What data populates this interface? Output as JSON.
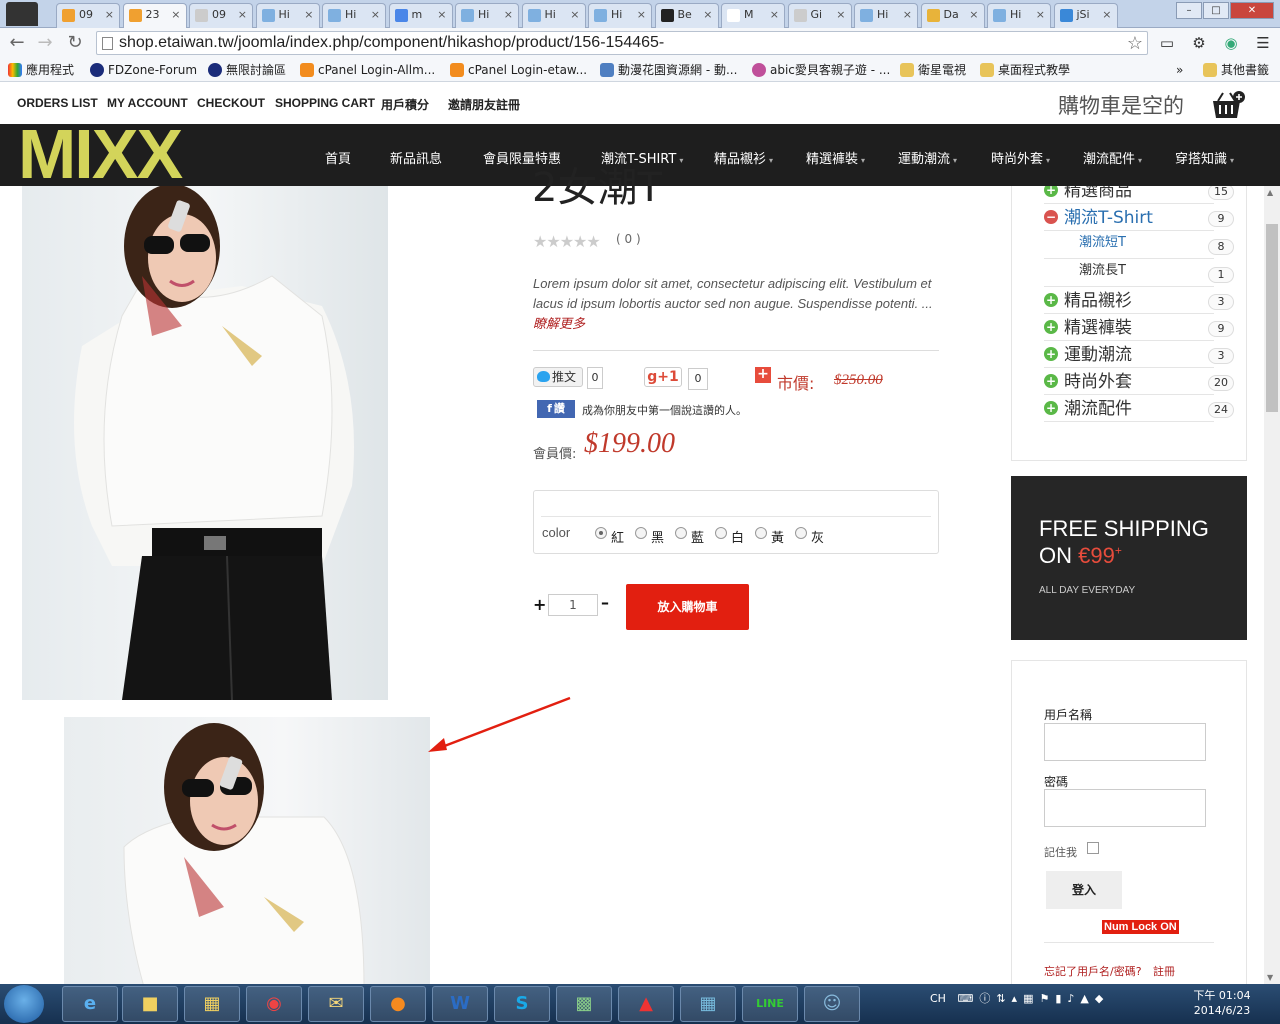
{
  "browser": {
    "tabs": [
      "09",
      "23",
      "09",
      "Hi",
      "Hi",
      "m",
      "Hi",
      "Hi",
      "Hi",
      "Be",
      "M",
      "Gi",
      "Hi",
      "Da",
      "Hi",
      "jSi"
    ],
    "url": "shop.etaiwan.tw/joomla/index.php/component/hikashop/product/156-154465-",
    "bookmarks": [
      "應用程式",
      "FDZone-Forum",
      "無限討論區",
      "cPanel Login-Allm...",
      "cPanel Login-etaw...",
      "動漫花園資源網 - 動...",
      "abic愛貝客親子遊 - ...",
      "衛星電視",
      "桌面程式教學"
    ],
    "other_bookmarks": "其他書籤",
    "bookmarks_more": "»"
  },
  "site": {
    "top_links": [
      "ORDERS LIST",
      "MY ACCOUNT",
      "CHECKOUT",
      "SHOPPING CART",
      "用戶積分",
      "邀請朋友註冊"
    ],
    "cart_status": "購物車是空的",
    "logo": "MIXX",
    "main_menu": [
      {
        "label": "首頁",
        "dropdown": false
      },
      {
        "label": "新品訊息",
        "dropdown": false
      },
      {
        "label": "會員限量特惠",
        "dropdown": false
      },
      {
        "label": "潮流T-SHIRT",
        "dropdown": true
      },
      {
        "label": "精品襯衫",
        "dropdown": true
      },
      {
        "label": "精選褲裝",
        "dropdown": true
      },
      {
        "label": "運動潮流",
        "dropdown": true
      },
      {
        "label": "時尚外套",
        "dropdown": true
      },
      {
        "label": "潮流配件",
        "dropdown": true
      },
      {
        "label": "穿搭知識",
        "dropdown": true
      }
    ],
    "caret": "▾"
  },
  "product": {
    "title_partial": "2女潮T",
    "rating_stars": "★★★★★",
    "rating_count": "( 0 )",
    "description": "Lorem ipsum dolor sit amet, consectetur adipiscing elit. Vestibulum et lacus id ipsum lobortis auctor sed non augue. Suspendisse potenti. ...",
    "read_more": "瞭解更多",
    "tweet_label": "推文",
    "tweet_count": "0",
    "gplus_label": "g+1",
    "gplus_count": "0",
    "market_price_label": "市價:",
    "market_price": "$250.00",
    "fb_like_label": "讚",
    "fb_like_text": "成為你朋友中第一個說這讚的人。",
    "member_price_label": "會員價:",
    "member_price": "$199.00",
    "option_label": "color",
    "color_options": [
      "紅",
      "黑",
      "藍",
      "白",
      "黃",
      "灰"
    ],
    "selected_color": "紅",
    "quantity": "1",
    "add_to_cart": "放入購物車"
  },
  "sidebar": {
    "categories": [
      {
        "label": "精選商品",
        "count": "15",
        "level": 0,
        "icon": "plus"
      },
      {
        "label": "潮流T-Shirt",
        "count": "9",
        "level": 0,
        "icon": "minus"
      },
      {
        "label": "潮流短T",
        "count": "8",
        "level": 1,
        "icon": ""
      },
      {
        "label": "潮流長T",
        "count": "1",
        "level": 1,
        "icon": ""
      },
      {
        "label": "精品襯衫",
        "count": "3",
        "level": 0,
        "icon": "plus"
      },
      {
        "label": "精選褲裝",
        "count": "9",
        "level": 0,
        "icon": "plus"
      },
      {
        "label": "運動潮流",
        "count": "3",
        "level": 0,
        "icon": "plus"
      },
      {
        "label": "時尚外套",
        "count": "20",
        "level": 0,
        "icon": "plus"
      },
      {
        "label": "潮流配件",
        "count": "24",
        "level": 0,
        "icon": "plus"
      }
    ],
    "shipping_line1": "FREE SHIPPING",
    "shipping_line2_prefix": "ON ",
    "shipping_amount": "€99",
    "shipping_plus": "+",
    "shipping_line3": "ALL DAY EVERYDAY",
    "login": {
      "username_label": "用戶名稱",
      "password_label": "密碼",
      "remember_label": "記住我",
      "login_button": "登入",
      "numlock_warning": "Num Lock ON",
      "forgot_link": "忘記了用戶名/密碼?",
      "register_link": "註冊"
    }
  },
  "taskbar": {
    "tray_lang": "CH",
    "clock_time": "下午 01:04",
    "clock_date": "2014/6/23"
  },
  "colors": {
    "accent_red": "#e21f10",
    "logo_yellow": "#d3d45a",
    "nav_bg": "#1e1e1e"
  }
}
